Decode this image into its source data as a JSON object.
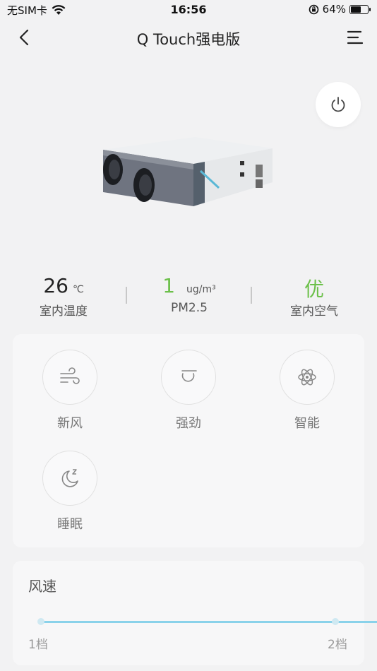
{
  "status_bar": {
    "carrier": "无SIM卡",
    "time": "16:56",
    "battery": "64%",
    "battery_level": 0.64
  },
  "nav": {
    "title": "Q Touch强电版"
  },
  "stats": [
    {
      "value": "26",
      "unit": "℃",
      "label": "室内温度"
    },
    {
      "value": "1",
      "unit": "ug/m³",
      "label": "PM2.5"
    },
    {
      "value": "优",
      "unit": "",
      "label": "室内空气"
    }
  ],
  "modes": [
    {
      "label": "新风",
      "icon": "wind-icon"
    },
    {
      "label": "强劲",
      "icon": "strong-icon"
    },
    {
      "label": "智能",
      "icon": "atom-icon"
    },
    {
      "label": "睡眠",
      "icon": "moon-sleep-icon"
    }
  ],
  "fan_speed": {
    "title": "风速",
    "min_label": "1档",
    "max_label": "2档"
  },
  "colors": {
    "accent_green": "#6cc04a",
    "slider_blue": "#8ad2ea"
  }
}
